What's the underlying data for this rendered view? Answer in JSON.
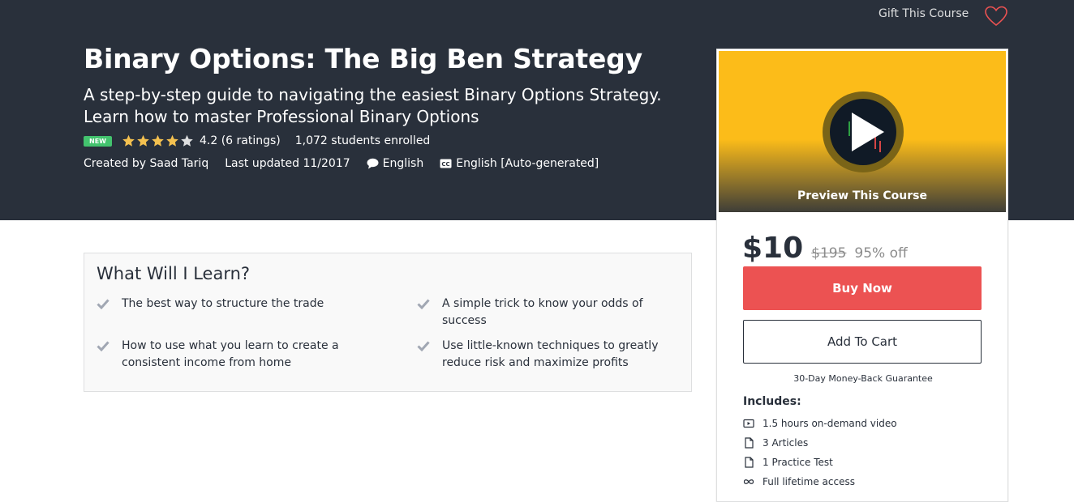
{
  "header": {
    "gift_label": "Gift This Course",
    "wishlist_icon": "heart-outline-icon"
  },
  "course": {
    "title": "Binary Options: The Big Ben Strategy",
    "subtitle": "A step-by-step guide to navigating the easiest Binary Options Strategy. Learn how to master Professional Binary Options",
    "badge": "NEW",
    "rating_value": 4.2,
    "rating_max": 5,
    "rating_text": "4.2 (6 ratings)",
    "enrolled": "1,072 students enrolled",
    "created_by": "Created by Saad Tariq",
    "last_updated": "Last updated 11/2017",
    "language": "English",
    "captions": "English [Auto-generated]"
  },
  "sidebar": {
    "preview_label": "Preview This Course",
    "price": "$10",
    "old_price": "$195",
    "discount": "95% off",
    "buy_now": "Buy Now",
    "add_to_cart": "Add To Cart",
    "guarantee": "30-Day Money-Back Guarantee",
    "includes_title": "Includes:",
    "includes": [
      {
        "icon": "video-icon",
        "label": "1.5 hours on-demand video"
      },
      {
        "icon": "file-icon",
        "label": "3 Articles"
      },
      {
        "icon": "file-icon",
        "label": "1 Practice Test"
      },
      {
        "icon": "infinity-icon",
        "label": "Full lifetime access"
      }
    ]
  },
  "learn": {
    "title": "What Will I Learn?",
    "items": [
      "The best way to structure the trade",
      "A simple trick to know your odds of success",
      "How to use what you learn to create a consistent income from home",
      "Use little-known techniques to greatly reduce risk and maximize profits"
    ]
  },
  "colors": {
    "hero_bg": "#29303b",
    "accent_red": "#ec5252",
    "star": "#f4c150",
    "preview_yellow": "#fcbc19",
    "badge_green": "#43c36e"
  }
}
